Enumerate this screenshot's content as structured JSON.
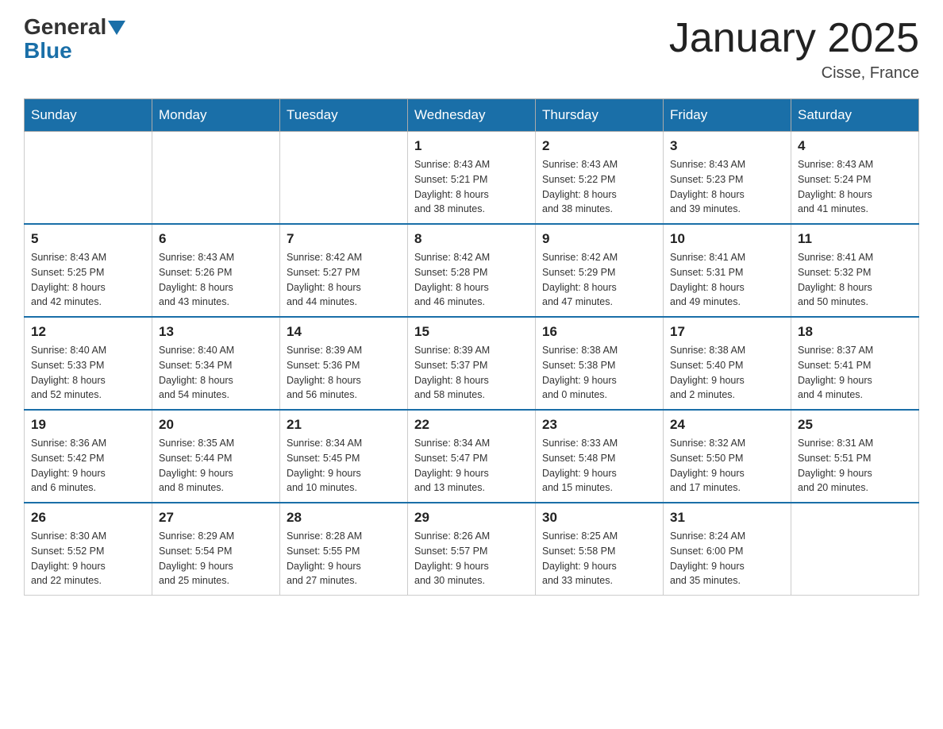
{
  "header": {
    "logo_general": "General",
    "logo_blue": "Blue",
    "title": "January 2025",
    "location": "Cisse, France"
  },
  "calendar": {
    "days_of_week": [
      "Sunday",
      "Monday",
      "Tuesday",
      "Wednesday",
      "Thursday",
      "Friday",
      "Saturday"
    ],
    "weeks": [
      [
        {
          "day": "",
          "info": ""
        },
        {
          "day": "",
          "info": ""
        },
        {
          "day": "",
          "info": ""
        },
        {
          "day": "1",
          "info": "Sunrise: 8:43 AM\nSunset: 5:21 PM\nDaylight: 8 hours\nand 38 minutes."
        },
        {
          "day": "2",
          "info": "Sunrise: 8:43 AM\nSunset: 5:22 PM\nDaylight: 8 hours\nand 38 minutes."
        },
        {
          "day": "3",
          "info": "Sunrise: 8:43 AM\nSunset: 5:23 PM\nDaylight: 8 hours\nand 39 minutes."
        },
        {
          "day": "4",
          "info": "Sunrise: 8:43 AM\nSunset: 5:24 PM\nDaylight: 8 hours\nand 41 minutes."
        }
      ],
      [
        {
          "day": "5",
          "info": "Sunrise: 8:43 AM\nSunset: 5:25 PM\nDaylight: 8 hours\nand 42 minutes."
        },
        {
          "day": "6",
          "info": "Sunrise: 8:43 AM\nSunset: 5:26 PM\nDaylight: 8 hours\nand 43 minutes."
        },
        {
          "day": "7",
          "info": "Sunrise: 8:42 AM\nSunset: 5:27 PM\nDaylight: 8 hours\nand 44 minutes."
        },
        {
          "day": "8",
          "info": "Sunrise: 8:42 AM\nSunset: 5:28 PM\nDaylight: 8 hours\nand 46 minutes."
        },
        {
          "day": "9",
          "info": "Sunrise: 8:42 AM\nSunset: 5:29 PM\nDaylight: 8 hours\nand 47 minutes."
        },
        {
          "day": "10",
          "info": "Sunrise: 8:41 AM\nSunset: 5:31 PM\nDaylight: 8 hours\nand 49 minutes."
        },
        {
          "day": "11",
          "info": "Sunrise: 8:41 AM\nSunset: 5:32 PM\nDaylight: 8 hours\nand 50 minutes."
        }
      ],
      [
        {
          "day": "12",
          "info": "Sunrise: 8:40 AM\nSunset: 5:33 PM\nDaylight: 8 hours\nand 52 minutes."
        },
        {
          "day": "13",
          "info": "Sunrise: 8:40 AM\nSunset: 5:34 PM\nDaylight: 8 hours\nand 54 minutes."
        },
        {
          "day": "14",
          "info": "Sunrise: 8:39 AM\nSunset: 5:36 PM\nDaylight: 8 hours\nand 56 minutes."
        },
        {
          "day": "15",
          "info": "Sunrise: 8:39 AM\nSunset: 5:37 PM\nDaylight: 8 hours\nand 58 minutes."
        },
        {
          "day": "16",
          "info": "Sunrise: 8:38 AM\nSunset: 5:38 PM\nDaylight: 9 hours\nand 0 minutes."
        },
        {
          "day": "17",
          "info": "Sunrise: 8:38 AM\nSunset: 5:40 PM\nDaylight: 9 hours\nand 2 minutes."
        },
        {
          "day": "18",
          "info": "Sunrise: 8:37 AM\nSunset: 5:41 PM\nDaylight: 9 hours\nand 4 minutes."
        }
      ],
      [
        {
          "day": "19",
          "info": "Sunrise: 8:36 AM\nSunset: 5:42 PM\nDaylight: 9 hours\nand 6 minutes."
        },
        {
          "day": "20",
          "info": "Sunrise: 8:35 AM\nSunset: 5:44 PM\nDaylight: 9 hours\nand 8 minutes."
        },
        {
          "day": "21",
          "info": "Sunrise: 8:34 AM\nSunset: 5:45 PM\nDaylight: 9 hours\nand 10 minutes."
        },
        {
          "day": "22",
          "info": "Sunrise: 8:34 AM\nSunset: 5:47 PM\nDaylight: 9 hours\nand 13 minutes."
        },
        {
          "day": "23",
          "info": "Sunrise: 8:33 AM\nSunset: 5:48 PM\nDaylight: 9 hours\nand 15 minutes."
        },
        {
          "day": "24",
          "info": "Sunrise: 8:32 AM\nSunset: 5:50 PM\nDaylight: 9 hours\nand 17 minutes."
        },
        {
          "day": "25",
          "info": "Sunrise: 8:31 AM\nSunset: 5:51 PM\nDaylight: 9 hours\nand 20 minutes."
        }
      ],
      [
        {
          "day": "26",
          "info": "Sunrise: 8:30 AM\nSunset: 5:52 PM\nDaylight: 9 hours\nand 22 minutes."
        },
        {
          "day": "27",
          "info": "Sunrise: 8:29 AM\nSunset: 5:54 PM\nDaylight: 9 hours\nand 25 minutes."
        },
        {
          "day": "28",
          "info": "Sunrise: 8:28 AM\nSunset: 5:55 PM\nDaylight: 9 hours\nand 27 minutes."
        },
        {
          "day": "29",
          "info": "Sunrise: 8:26 AM\nSunset: 5:57 PM\nDaylight: 9 hours\nand 30 minutes."
        },
        {
          "day": "30",
          "info": "Sunrise: 8:25 AM\nSunset: 5:58 PM\nDaylight: 9 hours\nand 33 minutes."
        },
        {
          "day": "31",
          "info": "Sunrise: 8:24 AM\nSunset: 6:00 PM\nDaylight: 9 hours\nand 35 minutes."
        },
        {
          "day": "",
          "info": ""
        }
      ]
    ]
  }
}
